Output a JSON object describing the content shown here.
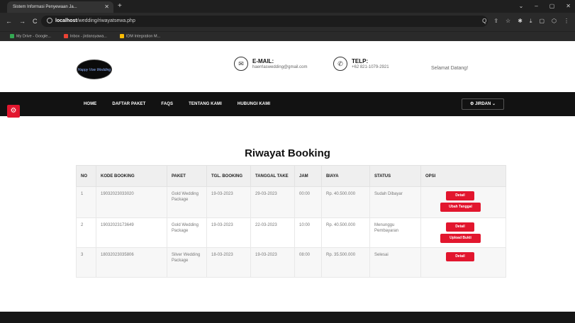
{
  "browser": {
    "tab_title": "Sistem Informasi Penyewaan Ja...",
    "tab_close": "✕",
    "new_tab": "+",
    "win_controls": [
      "⌄",
      "–",
      "▢",
      "✕"
    ],
    "nav_icons": [
      "←",
      "→",
      "C"
    ],
    "url_host": "localhost",
    "url_path": "/wedding/riwayatsewa.php",
    "toolbar_icons": [
      "Q",
      "⇪",
      "☆",
      "✱",
      "⤓",
      "▢",
      "⬡",
      "⋮"
    ],
    "bookmarks": [
      {
        "label": "My Drive - Google...",
        "color": "#34a853"
      },
      {
        "label": "Inbox - jirdansyawa...",
        "color": "#ea4335"
      },
      {
        "label": "IDM Integration M...",
        "color": "#fbbc04"
      }
    ]
  },
  "header": {
    "logo_text": "Happy Vow Wedding",
    "email_icon": "✉",
    "email_title": "E-MAIL:",
    "email_value": "haerrlaswedding@gmail.com",
    "phone_icon": "✆",
    "phone_title": "TELP:",
    "phone_value": "+62 821-1079-2921",
    "welcome": "Selamat Datang!"
  },
  "nav": {
    "items": [
      "HOME",
      "DAFTAR PAKET",
      "FAQS",
      "TENTANG KAMI",
      "HUBUNGI KAMI"
    ],
    "user_label": "⚙ JIRDAN ⌄"
  },
  "settings_icon": "⚙",
  "page": {
    "title": "Riwayat Booking"
  },
  "table": {
    "headers": [
      "NO",
      "KODE BOOKING",
      "PAKET",
      "TGL. BOOKING",
      "TANGGAL TAKE",
      "JAM",
      "BIAYA",
      "STATUS",
      "OPSI"
    ],
    "rows": [
      {
        "no": "1",
        "kode": "19032023033020",
        "paket": "Gold Wedding Package",
        "tgl": "19-03-2023",
        "take": "29-03-2023",
        "jam": "00:00",
        "biaya": "Rp. 40.500.000",
        "status": "Sudah Dibayar",
        "btn1": "Detail",
        "btn2": "Ubah Tanggal"
      },
      {
        "no": "2",
        "kode": "19032023173649",
        "paket": "Gold Wedding Package",
        "tgl": "19-03-2023",
        "take": "22-03-2023",
        "jam": "10:00",
        "biaya": "Rp. 40.500.000",
        "status": "Menunggu Pembayaran",
        "btn1": "Detail",
        "btn2": "Upload Bukti"
      },
      {
        "no": "3",
        "kode": "18032023035806",
        "paket": "Silver Wedding Package",
        "tgl": "18-03-2023",
        "take": "19-03-2023",
        "jam": "08:00",
        "biaya": "Rp. 35.500.000",
        "status": "Selesai",
        "btn1": "Detail",
        "btn2": ""
      }
    ]
  },
  "colors": {
    "accent": "#e2162e",
    "nav_bg": "#121212"
  }
}
